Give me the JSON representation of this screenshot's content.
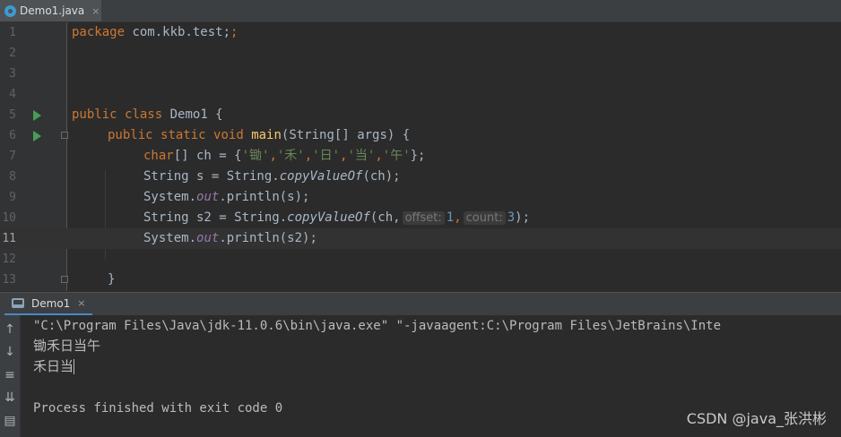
{
  "editor_tab": {
    "label": "Demo1.java",
    "close": "×"
  },
  "code_lines": [
    {
      "n": "1"
    },
    {
      "n": "2"
    },
    {
      "n": "3"
    },
    {
      "n": "4"
    },
    {
      "n": "5"
    },
    {
      "n": "6"
    },
    {
      "n": "7"
    },
    {
      "n": "8"
    },
    {
      "n": "9"
    },
    {
      "n": "10"
    },
    {
      "n": "11"
    },
    {
      "n": "12"
    },
    {
      "n": "13"
    }
  ],
  "code": {
    "l1": {
      "kw": "package",
      "rest": " com.kkb.test;"
    },
    "l5": {
      "kw1": "public",
      "kw2": "class",
      "rest": " Demo1 {"
    },
    "l6": {
      "kw1": "public",
      "kw2": "static",
      "kw3": "void",
      "fn": "main",
      "rest": "(String[] args) {"
    },
    "l7": {
      "kw": "char",
      "a": "[] ch = {",
      "c1": "'锄'",
      "c2": "'禾'",
      "c3": "'日'",
      "c4": "'当'",
      "c5": "'午'",
      "sep": ",",
      "end": "};"
    },
    "l8": {
      "a": "String s = String.",
      "m": "copyValueOf",
      "b": "(ch);"
    },
    "l9": {
      "a": "System.",
      "f": "out",
      "b": ".println(s);"
    },
    "l10": {
      "a": "String s2 = String.",
      "m": "copyValueOf",
      "b": "(ch,",
      "hint1": "offset:",
      "v1": "1",
      "c": ",",
      "hint2": "count:",
      "v2": "3",
      "d": ");"
    },
    "l11": {
      "a": "System.",
      "f": "out",
      "b": ".println(s2);"
    },
    "l13": {
      "a": "}"
    }
  },
  "run_tab": {
    "label": "Demo1",
    "close": "×"
  },
  "console": {
    "cmd": "\"C:\\Program Files\\Java\\jdk-11.0.6\\bin\\java.exe\" \"-javaagent:C:\\Program Files\\JetBrains\\Inte",
    "out1": "锄禾日当午",
    "out2": "禾日当",
    "exit": "Process finished with exit code 0"
  },
  "tools": [
    "arrow-up-icon",
    "arrow-down-icon",
    "soft-wrap-icon",
    "scroll-to-end-icon",
    "print-icon"
  ],
  "watermark": "CSDN @java_张洪彬"
}
